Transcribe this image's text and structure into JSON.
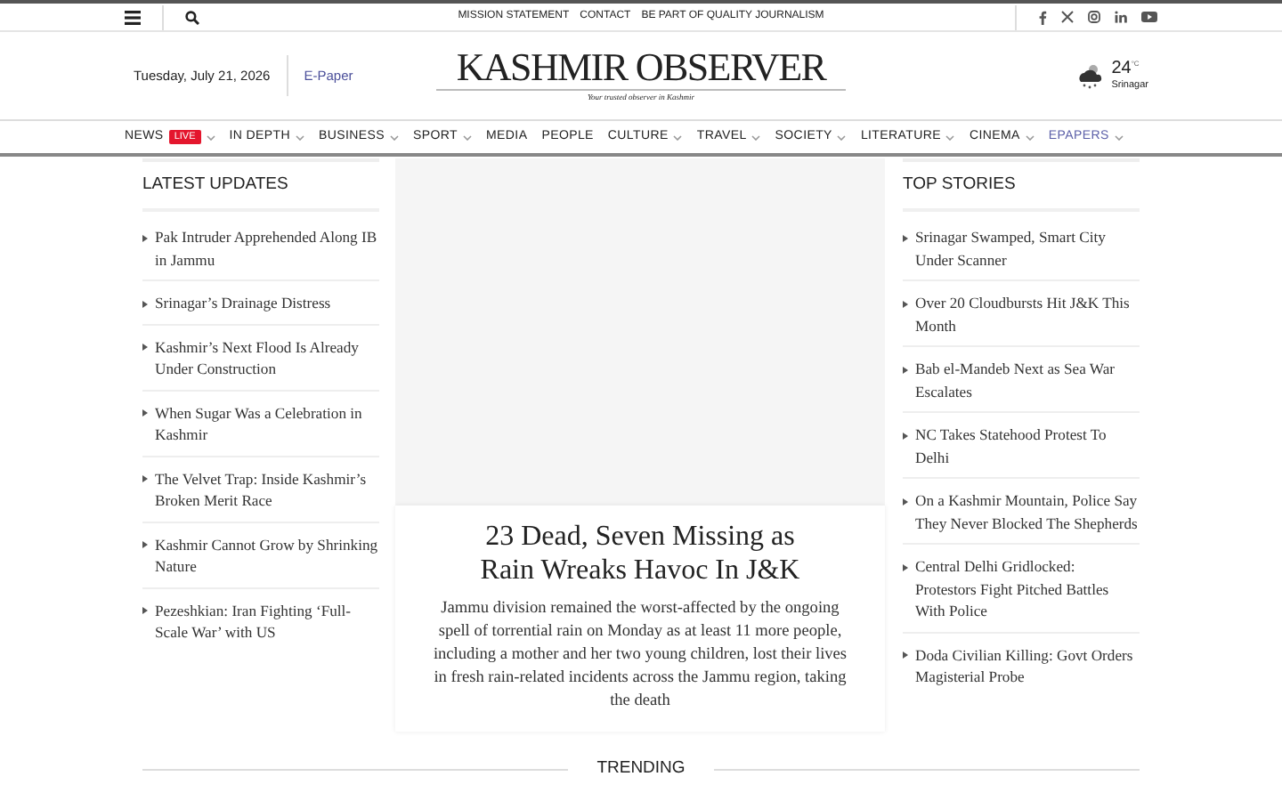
{
  "top_bar": {
    "links": [
      "MISSION STATEMENT",
      "CONTACT",
      "BE PART OF QUALITY JOURNALISM"
    ]
  },
  "header": {
    "date": "Tuesday, July 21, 2026",
    "epaper_link": "E-Paper",
    "logo": "KASHMIR OBSERVER",
    "tagline": "Your trusted observer in Kashmir",
    "weather": {
      "temperature": "24",
      "unit": "°C",
      "city": "Srinagar"
    }
  },
  "nav": [
    {
      "label": "NEWS",
      "badge": "LIVE",
      "dropdown": true,
      "kind": "plain"
    },
    {
      "label": "IN DEPTH",
      "dropdown": true,
      "kind": "plain"
    },
    {
      "label": "BUSINESS",
      "dropdown": true,
      "kind": "plain"
    },
    {
      "label": "SPORT",
      "dropdown": true,
      "kind": "plain"
    },
    {
      "label": "MEDIA",
      "dropdown": false,
      "kind": "plain"
    },
    {
      "label": "PEOPLE",
      "dropdown": false,
      "kind": "plain"
    },
    {
      "label": "CULTURE",
      "dropdown": true,
      "kind": "plain"
    },
    {
      "label": "TRAVEL",
      "dropdown": true,
      "kind": "plain"
    },
    {
      "label": "SOCIETY",
      "dropdown": true,
      "kind": "plain"
    },
    {
      "label": "LITERATURE",
      "dropdown": true,
      "kind": "plain"
    },
    {
      "label": "CINEMA",
      "dropdown": true,
      "kind": "plain"
    },
    {
      "label": "EPAPERS",
      "dropdown": true,
      "kind": "accent"
    }
  ],
  "latest_updates": {
    "title": "LATEST UPDATES",
    "items": [
      "Pak Intruder Apprehended Along IB in Jammu",
      "Srinagar’s Drainage Distress",
      "Kashmir’s Next Flood Is Already Under Construction",
      "When Sugar Was a Celebration in Kashmir",
      "The Velvet Trap: Inside Kashmir’s Broken Merit Race",
      "Kashmir Cannot Grow by Shrinking Nature",
      "Pezeshkian: Iran Fighting ‘Full-Scale War’ with US"
    ]
  },
  "featured": {
    "headline": "23 Dead, Seven Missing as Rain Wreaks Havoc In J&K",
    "summary": "Jammu division remained the worst-affected by the ongoing spell of torrential rain on Monday as at least 11 more people, including a mother and her two young children, lost their lives in fresh rain-related incidents across the Jammu region, taking the death"
  },
  "top_stories": {
    "title": "TOP STORIES",
    "items": [
      "Srinagar Swamped, Smart City Under Scanner",
      "Over 20 Cloudbursts Hit J&K This Month",
      "Bab el-Mandeb Next as Sea War Escalates",
      "NC Takes Statehood Protest To Delhi",
      "On a Kashmir Mountain, Police Say They Never Blocked The Shepherds",
      "Central Delhi Gridlocked: Protestors Fight Pitched Battles With Police",
      "Doda Civilian Killing: Govt Orders Magisterial Probe"
    ]
  },
  "trending": {
    "title": "TRENDING"
  }
}
